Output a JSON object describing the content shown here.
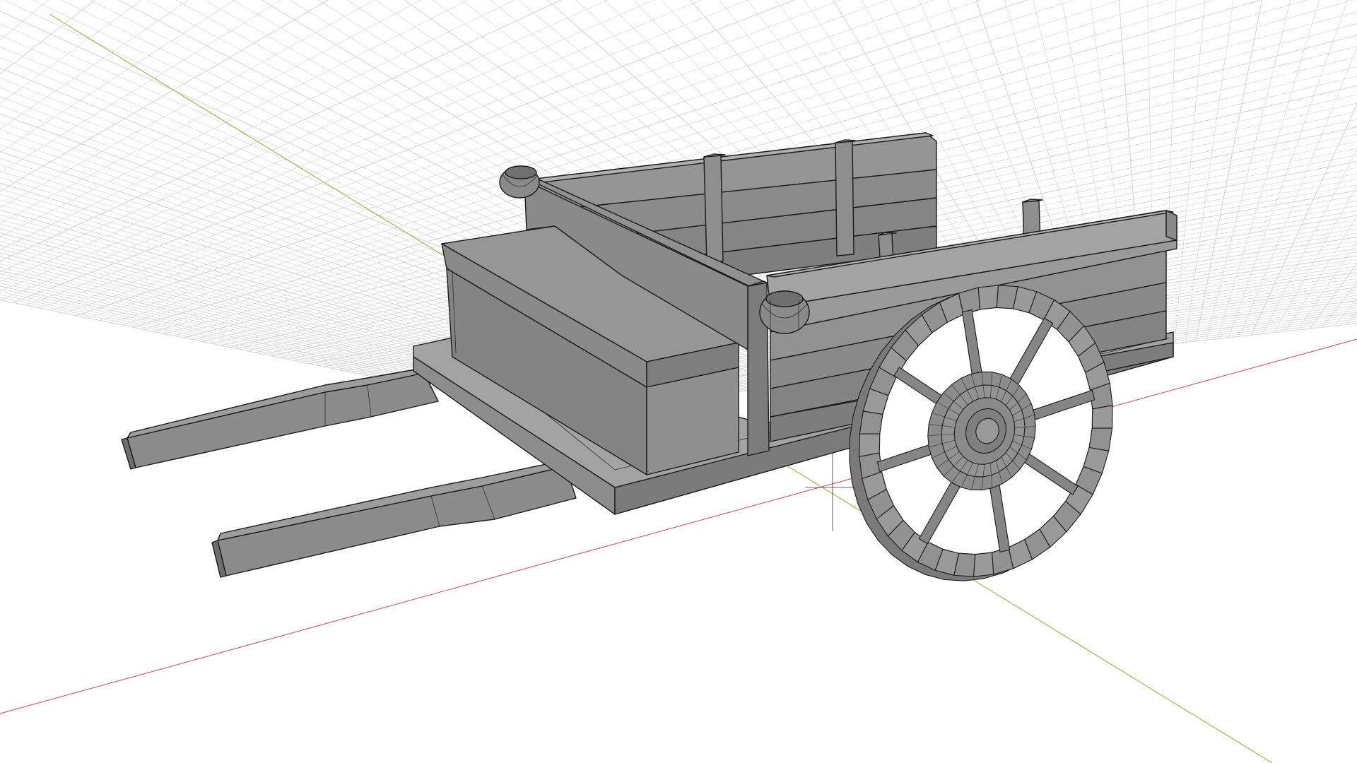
{
  "viewport": {
    "view_mode": "perspective",
    "shading": "solid-with-wireframe",
    "grid_visible": true,
    "background_color": "#ffffff",
    "grid_color": "#d6d6d6",
    "x_axis_color": "#c9656f",
    "y_axis_color": "#a9b35a"
  },
  "scene": {
    "objects": [
      {
        "name": "cart-bed",
        "icon": "box-mesh-icon"
      },
      {
        "name": "seat-box",
        "icon": "box-mesh-icon"
      },
      {
        "name": "front-panel",
        "icon": "box-mesh-icon"
      },
      {
        "name": "side-rails",
        "icon": "box-mesh-icon"
      },
      {
        "name": "handles",
        "icon": "box-mesh-icon"
      },
      {
        "name": "wheel",
        "icon": "cylinder-mesh-icon"
      },
      {
        "name": "posts",
        "icon": "box-mesh-icon"
      },
      {
        "name": "barrel-caps",
        "icon": "cylinder-mesh-icon"
      }
    ],
    "material_colors": {
      "top": "#9a9a9a",
      "side": "#8a8a8a",
      "dark": "#6f6f6f",
      "light": "#a8a8a8"
    }
  }
}
